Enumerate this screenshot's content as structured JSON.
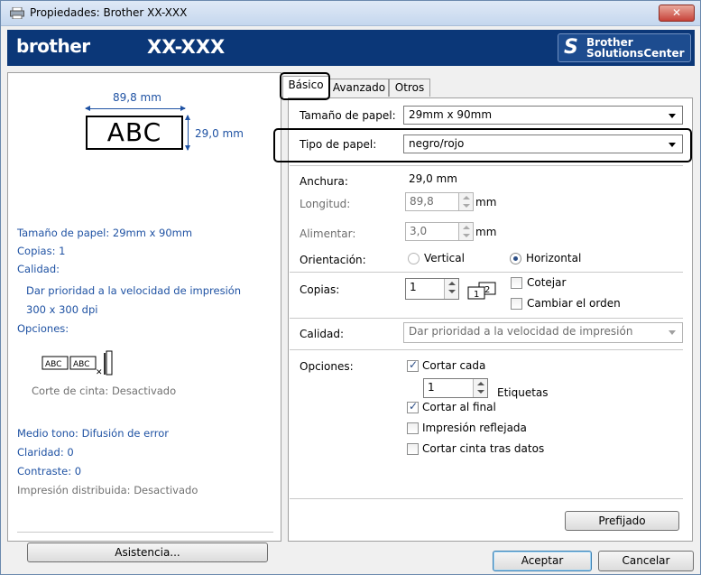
{
  "window": {
    "title": "Propiedades: Brother XX-XXX",
    "close_label": "✕"
  },
  "banner": {
    "logo": "brother",
    "model": "XX-XXX",
    "solutions_line1": "Brother",
    "solutions_line2": "SolutionsCenter"
  },
  "preview": {
    "width_label": "89,8 mm",
    "height_label": "29,0 mm",
    "sample_text": "ABC",
    "paper_size": "Tamaño de papel: 29mm x 90mm",
    "copies": "Copias: 1",
    "quality_heading": "Calidad:",
    "quality_value": "Dar prioridad  a la velocidad de impresión",
    "resolution": "300 x 300 dpi",
    "options_heading": "Opciones:",
    "tape_cut": "Corte de cinta: Desactivado",
    "halftone": "Medio tono: Difusión de error",
    "brightness": "Claridad:  0",
    "contrast": "Contraste:  0",
    "distributed": "Impresión distribuida: Desactivado",
    "assist_button": "Asistencia..."
  },
  "tabs": [
    {
      "label": "Básico"
    },
    {
      "label": "Avanzado"
    },
    {
      "label": "Otros"
    }
  ],
  "basic": {
    "paper_size_label": "Tamaño de papel:",
    "paper_size_value": "29mm x 90mm",
    "paper_type_label": "Tipo de papel:",
    "paper_type_value": "negro/rojo",
    "width_label": "Anchura:",
    "width_value": "29,0 mm",
    "length_label": "Longitud:",
    "length_value": "89,8",
    "length_unit": "mm",
    "feed_label": "Alimentar:",
    "feed_value": "3,0",
    "feed_unit": "mm",
    "orientation_label": "Orientación:",
    "orientation_vertical": "Vertical",
    "orientation_horizontal": "Horizontal",
    "orientation_selected": "Horizontal",
    "copies_label": "Copias:",
    "copies_value": "1",
    "collate_label": "Cotejar",
    "reverse_label": "Cambiar el orden",
    "quality_label": "Calidad:",
    "quality_value": "Dar prioridad  a la velocidad de impresión",
    "options_label": "Opciones:",
    "cut_every_label": "Cortar cada",
    "cut_every_value": "1",
    "labels_unit": "Etiquetas",
    "cut_at_end_label": "Cortar al final",
    "mirror_label": "Impresión reflejada",
    "cut_tape_label": "Cortar cinta tras datos",
    "checks": {
      "collate": false,
      "reverse": false,
      "cut_every": true,
      "cut_at_end": true,
      "mirror": false,
      "cut_tape": false
    },
    "default_button": "Prefijado"
  },
  "footer": {
    "ok_button": "Aceptar",
    "cancel_button": "Cancelar"
  },
  "colors": {
    "banner": "#0b3778",
    "info_text": "#1f52a3"
  }
}
